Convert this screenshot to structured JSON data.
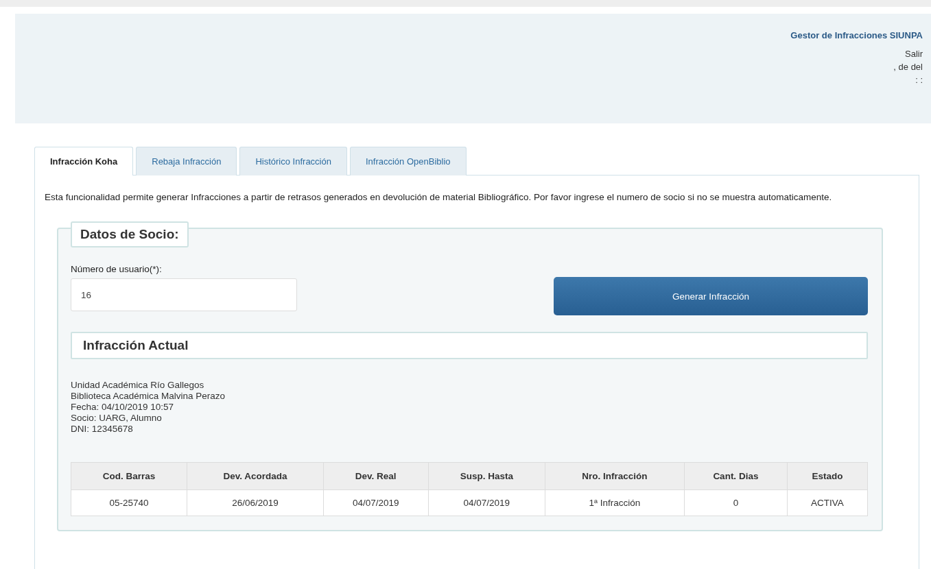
{
  "header": {
    "title": "Gestor de Infracciones SIUNPA",
    "logout": "Salir",
    "user_line": ", de del",
    "time_line": ": :"
  },
  "tabs": [
    {
      "label": "Infracción Koha",
      "selected": true
    },
    {
      "label": "Rebaja Infracción",
      "selected": false
    },
    {
      "label": "Histórico Infracción",
      "selected": false
    },
    {
      "label": "Infracción OpenBiblio",
      "selected": false
    }
  ],
  "description": "Esta funcionalidad permite generar Infracciones a partir de retrasos generados en devolución de material Bibliográfico. Por favor ingrese el numero de socio si no se muestra automaticamente.",
  "member": {
    "legend": "Datos de Socio:",
    "field_label": "Número de usuario(*):",
    "value": "16",
    "button": "Generar Infracción"
  },
  "current": {
    "title": "Infracción Actual",
    "lines": [
      "Unidad Académica Río Gallegos",
      "Biblioteca Académica Malvina Perazo",
      "Fecha: 04/10/2019 10:57",
      "Socio: UARG, Alumno",
      "DNI: 12345678"
    ]
  },
  "table": {
    "columns": [
      "Cod. Barras",
      "Dev. Acordada",
      "Dev. Real",
      "Susp. Hasta",
      "Nro. Infracción",
      "Cant. Dias",
      "Estado"
    ],
    "rows": [
      [
        "05-25740",
        "26/06/2019",
        "04/07/2019",
        "04/07/2019",
        "1ª Infracción",
        "0",
        "ACTIVA"
      ]
    ]
  }
}
